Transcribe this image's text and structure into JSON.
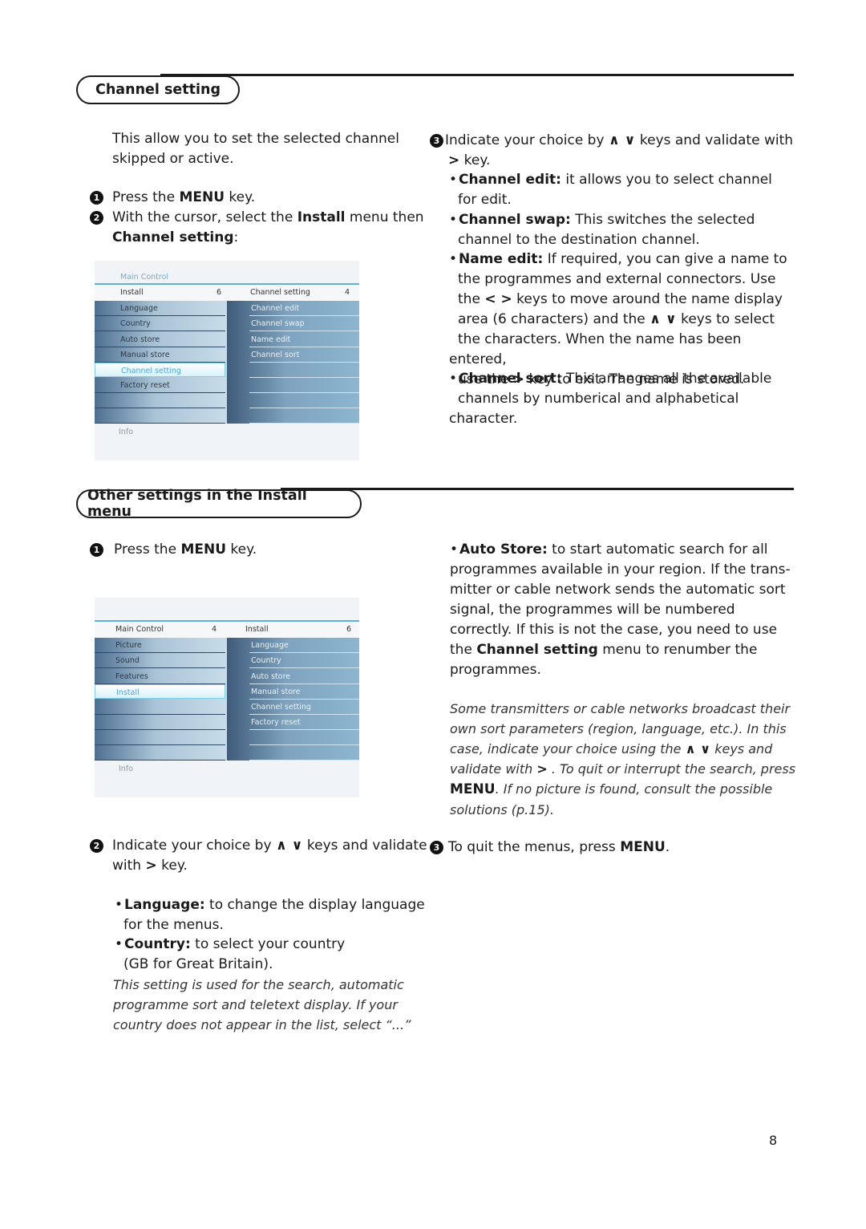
{
  "section1": {
    "title": "Channel setting",
    "intro": "This allow you to set the selected channel skipped or active.",
    "step1": {
      "num": "1",
      "pre": "Press the ",
      "key": "MENU",
      "post": " key."
    },
    "step2": {
      "num": "2",
      "pre": "With the cursor, select the ",
      "bold1": "Install",
      "mid": " menu then",
      "bold2": "Channel setting",
      "post": ":"
    },
    "menu": {
      "breadcrumb": "Main Control",
      "left_header": "Install",
      "left_count": "6",
      "right_header": "Channel setting",
      "right_count": "4",
      "left_items": [
        "Language",
        "Country",
        "Auto store",
        "Manual store",
        "Channel setting",
        "Factory reset"
      ],
      "selected_index": 4,
      "right_items": [
        "Channel edit",
        "Channel swap",
        "Name edit",
        "Channel sort"
      ],
      "info_label": "Info"
    },
    "step3": {
      "num": "3",
      "line1_pre": "Indicate your choice by ",
      "keys_updown": "∧ ∨",
      "line1_post": " keys and validate with",
      "key_right": ">",
      "line2_post": " key."
    },
    "bullets": [
      {
        "term": "Channel edit:",
        "text": " it allows you to select channel",
        "cont": "for edit."
      },
      {
        "term": "Channel swap:",
        "text": " This switches the selected",
        "cont": "channel to the destination channel."
      },
      {
        "term": "Name edit:",
        "text": " If required, you can give a name to"
      },
      {
        "term": "Channel sort:",
        "text": " This arranges all the available",
        "cont": "channels by numberical and alphabetical character."
      }
    ],
    "name_edit_lines": {
      "l1": "the programmes and external connectors. Use",
      "l2_pre": "the ",
      "l2_keys": "< >",
      "l2_post": " keys to move around the name display",
      "l3_pre": "area (6 characters) and the ",
      "l3_keys": "∧ ∨",
      "l3_post": " keys to select",
      "l4": "the characters. When the name has been entered,",
      "l5_pre": "use the ",
      "l5_key": ">",
      "l5_post": " key to exit. The name is stored."
    }
  },
  "section2": {
    "title": "Other settings in the Install menu",
    "step1": {
      "num": "1",
      "pre": "Press the ",
      "key": "MENU",
      "post": " key."
    },
    "menu": {
      "left_header": "Main Control",
      "left_count": "4",
      "right_header": "Install",
      "right_count": "6",
      "left_items": [
        "Picture",
        "Sound",
        "Features",
        "Install"
      ],
      "selected_index": 3,
      "right_items": [
        "Language",
        "Country",
        "Auto store",
        "Manual store",
        "Channel setting",
        "Factory reset"
      ],
      "info_label": "Info"
    },
    "step2": {
      "num": "2",
      "line1_pre": "Indicate your choice by ",
      "keys_updown": "∧ ∨",
      "line1_post": " keys and validate",
      "line2_pre": "with ",
      "key_right": ">",
      "line2_post": " key."
    },
    "bullets": [
      {
        "term": "Language:",
        "text": " to change the display language",
        "cont": "for the menus."
      },
      {
        "term": "Country:",
        "text": " to select your country",
        "cont": "(GB for Great Britain)."
      }
    ],
    "country_note": [
      "This setting is used for the search, automatic",
      "programme sort and teletext display. If your",
      "country does not appear in the list, select “...”"
    ],
    "auto_store": {
      "term": "Auto Store:",
      "l1": " to start automatic search for all",
      "l2": "programmes available in your region. If the trans-",
      "l3": "mitter or cable network sends the automatic sort",
      "l4": "signal, the programmes will be numbered",
      "l5": "correctly. If this is not the case, you need to use",
      "l6_pre": "the ",
      "l6_bold": "Channel setting",
      "l6_post": " menu to renumber the",
      "l7": "programmes."
    },
    "auto_note": {
      "l1": "Some transmitters or cable networks broadcast their",
      "l2": "own sort parameters (region, language, etc.). In this",
      "l3_pre": "case, indicate your choice using the ",
      "l3_keys": "∧ ∨",
      "l3_post": " keys and",
      "l4_pre": "validate with ",
      "l4_key": ">",
      "l4_post": " . To quit or interrupt the search, press",
      "l5_key": "MENU",
      "l5_post": ". If no picture is found, consult the possible",
      "l6": "solutions (p.15)."
    },
    "step3": {
      "num": "3",
      "pre": "To quit the menus, press ",
      "key": "MENU",
      "post": "."
    }
  },
  "page_number": "8"
}
